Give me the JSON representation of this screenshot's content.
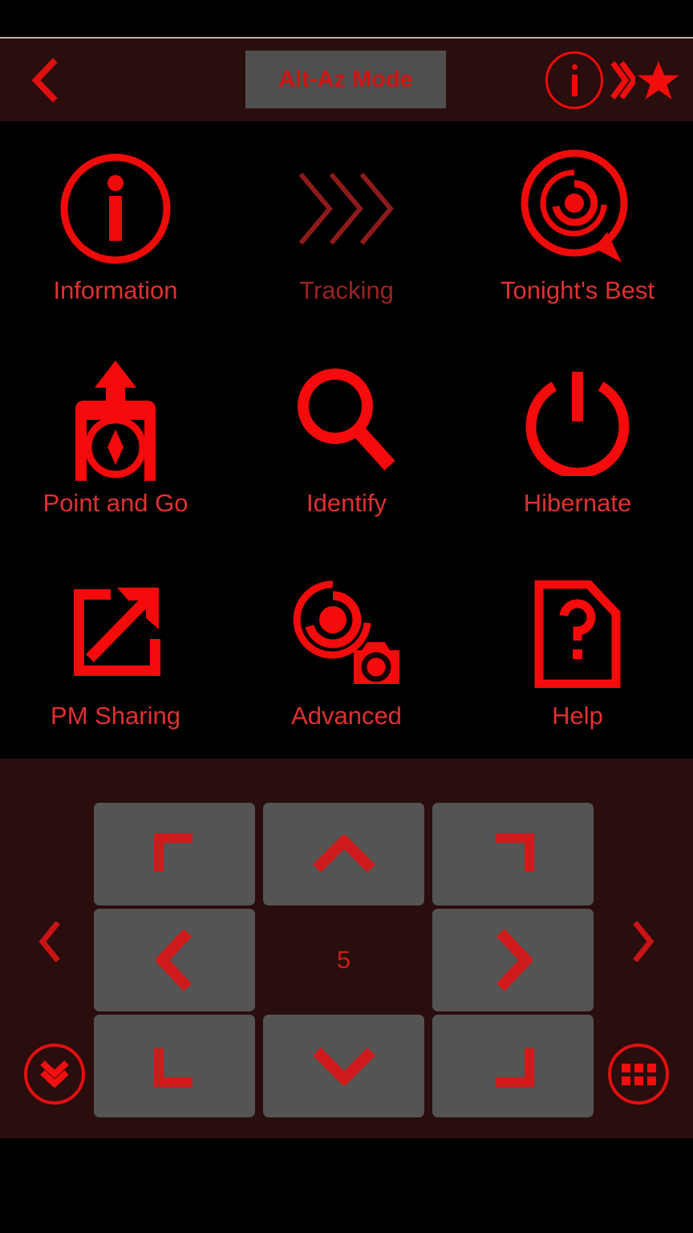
{
  "app": {
    "theme_accent": "#f00b0b",
    "bar_bg": "#2a0d0d",
    "panel_bg": "#000000",
    "button_bg": "#545454"
  },
  "header": {
    "back_icon": "chevron-left-icon",
    "mode_label": "Alt-Az Mode",
    "info_icon": "info-circle-icon",
    "star_icon": "chevron-star-icon"
  },
  "menu": {
    "items": [
      {
        "label": "Information",
        "icon": "info-circle-icon",
        "enabled": true
      },
      {
        "label": "Tracking",
        "icon": "triple-chevron-icon",
        "enabled": false
      },
      {
        "label": "Tonight's Best",
        "icon": "galaxy-bubble-icon",
        "enabled": true
      },
      {
        "label": "Point and Go",
        "icon": "phone-compass-icon",
        "enabled": true
      },
      {
        "label": "Identify",
        "icon": "magnifier-icon",
        "enabled": true
      },
      {
        "label": "Hibernate",
        "icon": "power-icon",
        "enabled": true
      },
      {
        "label": "PM Sharing",
        "icon": "share-external-icon",
        "enabled": true
      },
      {
        "label": "Advanced",
        "icon": "galaxy-camera-icon",
        "enabled": true
      },
      {
        "label": "Help",
        "icon": "document-question-icon",
        "enabled": true
      }
    ]
  },
  "dpad": {
    "speed_value": "5",
    "prev_icon": "chevron-left-icon",
    "next_icon": "chevron-right-icon",
    "buttons": [
      {
        "name": "corner-top-left",
        "icon": "corner-top-left-icon"
      },
      {
        "name": "up",
        "icon": "chevron-up-icon"
      },
      {
        "name": "corner-top-right",
        "icon": "corner-top-right-icon"
      },
      {
        "name": "left",
        "icon": "chevron-left-icon"
      },
      {
        "name": "speed",
        "icon": "speed-value"
      },
      {
        "name": "right",
        "icon": "chevron-right-icon"
      },
      {
        "name": "corner-bottom-left",
        "icon": "corner-bottom-left-icon"
      },
      {
        "name": "down",
        "icon": "chevron-down-icon"
      },
      {
        "name": "corner-bottom-right",
        "icon": "corner-bottom-right-icon"
      }
    ],
    "collapse_icon": "double-chevron-down-icon",
    "keypad_icon": "grid-apps-icon"
  }
}
